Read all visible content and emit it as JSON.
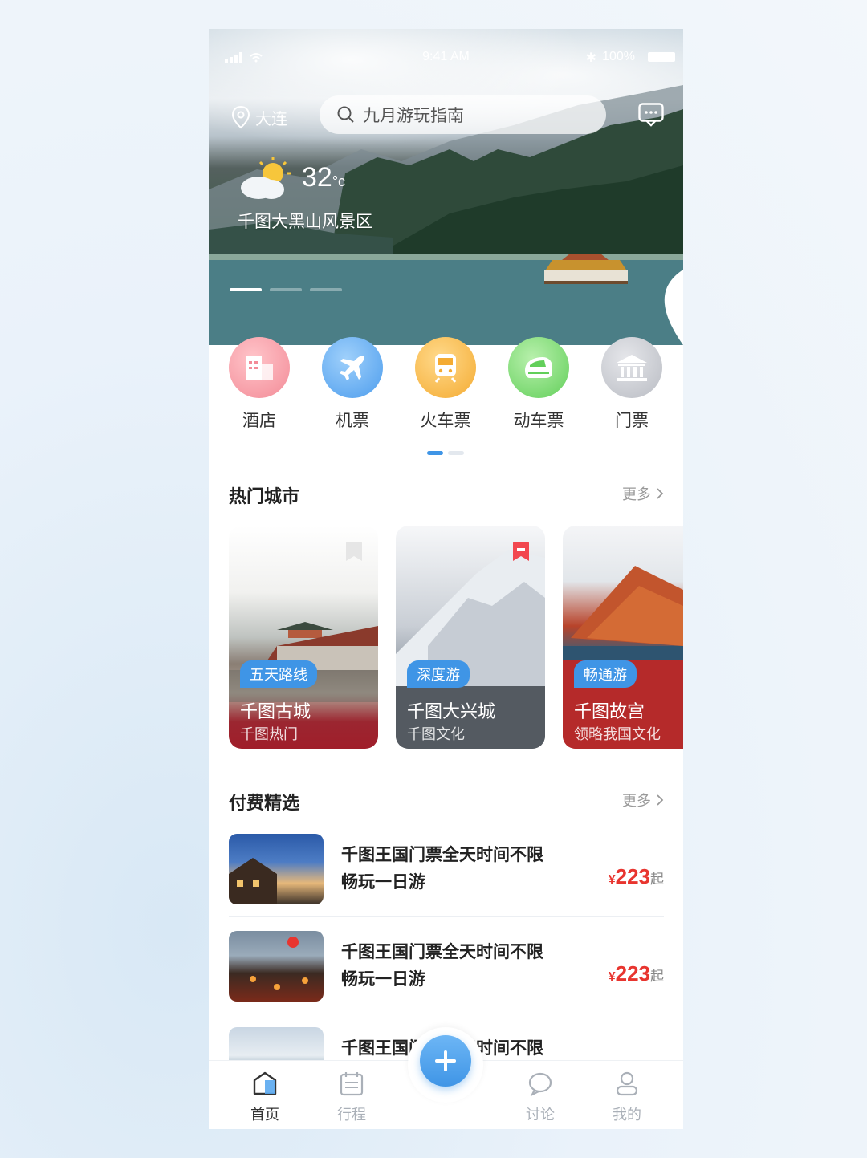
{
  "status_bar": {
    "time": "9:41 AM",
    "battery": "100%"
  },
  "header": {
    "location": "大连",
    "search_placeholder": "九月游玩指南"
  },
  "weather": {
    "temp": "32",
    "unit": "°c",
    "spot": "千图大黑山风景区"
  },
  "categories": [
    {
      "label": "酒店",
      "icon": "hotel-icon",
      "color": "#f49ca5"
    },
    {
      "label": "机票",
      "icon": "plane-icon",
      "color": "#5aa8ef"
    },
    {
      "label": "火车票",
      "icon": "train-icon",
      "color": "#f6b64a"
    },
    {
      "label": "动车票",
      "icon": "bullet-train-icon",
      "color": "#7dd872"
    },
    {
      "label": "门票",
      "icon": "museum-icon",
      "color": "#c9cbd0"
    }
  ],
  "hot_cities": {
    "title": "热门城市",
    "more": "更多",
    "cards": [
      {
        "tag": "五天路线",
        "name": "千图古城",
        "sub": "千图热门"
      },
      {
        "tag": "深度游",
        "name": "千图大兴城",
        "sub": "千图文化"
      },
      {
        "tag": "畅通游",
        "name": "千图故宫",
        "sub": "领略我国文化"
      }
    ]
  },
  "paid_picks": {
    "title": "付费精选",
    "more": "更多",
    "items": [
      {
        "line1": "千图王国门票全天时间不限",
        "line2": "畅玩一日游",
        "currency": "¥",
        "price": "223",
        "suffix": "起"
      },
      {
        "line1": "千图王国门票全天时间不限",
        "line2": "畅玩一日游",
        "currency": "¥",
        "price": "223",
        "suffix": "起"
      },
      {
        "line1": "千图王国门票全天时间不限",
        "line2": "",
        "currency": "",
        "price": "",
        "suffix": ""
      }
    ]
  },
  "tabbar": {
    "tabs": [
      {
        "label": "首页",
        "icon": "home-icon",
        "active": true
      },
      {
        "label": "行程",
        "icon": "calendar-icon",
        "active": false
      },
      {
        "label": "讨论",
        "icon": "chat-icon",
        "active": false
      },
      {
        "label": "我的",
        "icon": "user-icon",
        "active": false
      }
    ],
    "fab_icon": "plus-icon"
  },
  "colors": {
    "accent": "#3f95e6",
    "price": "#e8352f"
  }
}
